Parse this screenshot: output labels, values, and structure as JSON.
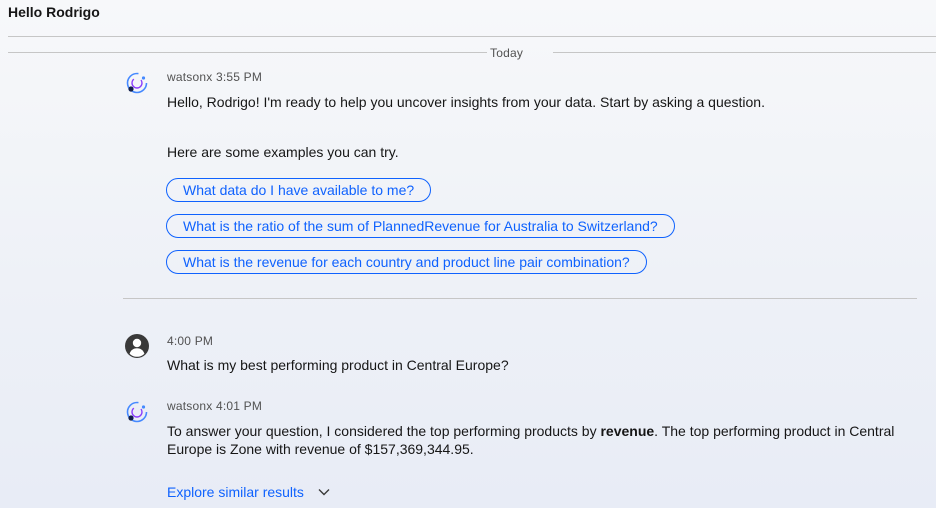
{
  "header": {
    "title": "Hello Rodrigo"
  },
  "date_divider": {
    "label": "Today"
  },
  "messages": [
    {
      "sender": "watsonx",
      "time": "3:55 PM",
      "greeting": "Hello, Rodrigo! I'm ready to help you uncover insights from your data. Start by asking a question.",
      "examples_intro": "Here are some examples you can try.",
      "suggestions": [
        "What data do I have available to me?",
        "What is the ratio of the sum of PlannedRevenue for Australia to Switzerland?",
        "What is the revenue for each country and product line pair combination?"
      ]
    },
    {
      "sender": "",
      "time": "4:00 PM",
      "text": "What is my best performing product in Central Europe?"
    },
    {
      "sender": "watsonx",
      "time": "4:01 PM",
      "text_before_bold": "To answer your question, I considered the top performing products by ",
      "bold": "revenue",
      "text_after_bold": ". The top performing product in Central Europe is Zone with revenue of $157,369,344.95.",
      "explore_label": "Explore similar results"
    }
  ],
  "colors": {
    "accent": "#0f62fe",
    "avatar_user": "#393939",
    "watsonx_ring": "#4589ff",
    "watsonx_dot": "#0f1d4a"
  },
  "icons": {
    "watsonx_avatar": "watsonx-icon",
    "user_avatar": "user-avatar-icon",
    "expand": "chevron-down-icon"
  }
}
